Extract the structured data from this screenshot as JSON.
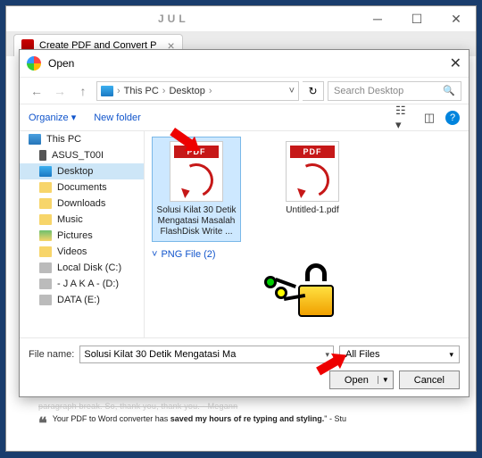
{
  "titlebar": {
    "center_text": "JUL"
  },
  "tab": {
    "label": "Create PDF and Convert P"
  },
  "dialog": {
    "title": "Open"
  },
  "breadcrumb": {
    "root": "This PC",
    "current": "Desktop"
  },
  "search": {
    "placeholder": "Search Desktop"
  },
  "toolbar": {
    "organize": "Organize",
    "newfolder": "New folder"
  },
  "sidebar": {
    "root": "This PC",
    "items": [
      "ASUS_T00I",
      "Desktop",
      "Documents",
      "Downloads",
      "Music",
      "Pictures",
      "Videos",
      "Local Disk (C:)",
      "- J A K A - (D:)",
      "DATA (E:)"
    ]
  },
  "files": {
    "pdf_badge": "PDF",
    "sel_name": "Solusi Kilat 30 Detik Mengatasi Masalah FlashDisk Write ...",
    "other_name": "Untitled-1.pdf",
    "group": "PNG File (2)"
  },
  "bottom": {
    "filename_label": "File name:",
    "filename_value": "Solusi Kilat 30 Detik Mengatasi Ma",
    "filter": "All Files",
    "open": "Open",
    "cancel": "Cancel"
  },
  "background": {
    "line1": "paragraph break. So, thank you, thank you. - Megann",
    "quote": "Your PDF to Word converter has ",
    "quote_bold": "saved my hours of re typing and styling.",
    "quote_end": "\" - Stu"
  }
}
